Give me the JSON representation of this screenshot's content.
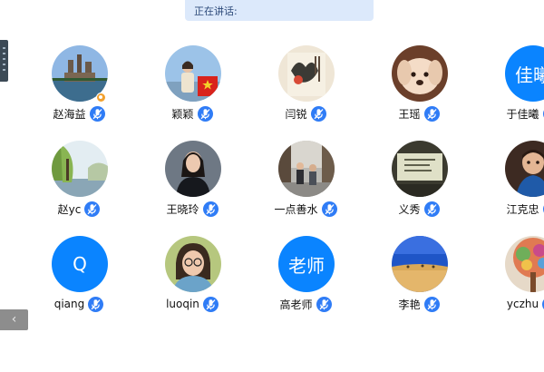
{
  "status": {
    "text": "正在讲话:"
  },
  "participants": [
    {
      "name": "赵海益",
      "avatar": "photo-castle",
      "host": true
    },
    {
      "name": "颖颖",
      "avatar": "photo-woman-flag"
    },
    {
      "name": "闫锐",
      "avatar": "photo-painting"
    },
    {
      "name": "王瑶",
      "avatar": "photo-dog"
    },
    {
      "name": "于佳曦",
      "avatar": "text",
      "avatar_text": "佳曦"
    },
    {
      "name": "赵yc",
      "avatar": "photo-willow"
    },
    {
      "name": "王晓玲",
      "avatar": "photo-woman-dark"
    },
    {
      "name": "一点善水",
      "avatar": "photo-street"
    },
    {
      "name": "义秀",
      "avatar": "photo-screen"
    },
    {
      "name": "江克忠",
      "avatar": "photo-child"
    },
    {
      "name": "qiang",
      "avatar": "text",
      "avatar_text": "Q"
    },
    {
      "name": "luoqin",
      "avatar": "photo-woman-glasses"
    },
    {
      "name": "高老师",
      "avatar": "text",
      "avatar_text": "老师"
    },
    {
      "name": "李艳",
      "avatar": "photo-beach"
    },
    {
      "name": "yczhu",
      "avatar": "photo-tree"
    }
  ],
  "colors": {
    "accent": "#0a84ff",
    "mic": "#2f7cf6",
    "banner": "#dce9fb"
  },
  "icons": {
    "mic": "microphone-muted-icon",
    "collapse": "chevron-left-icon"
  }
}
